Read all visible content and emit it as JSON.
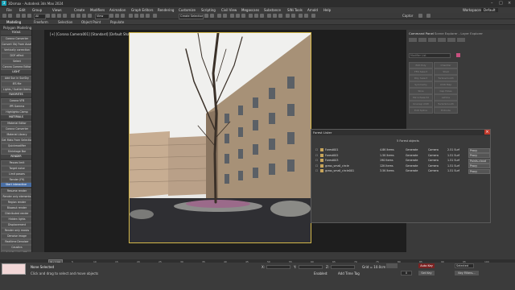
{
  "app": {
    "title": "3Dsmax - Autodesk 3ds Max 2024",
    "menus": [
      "File",
      "Edit",
      "Group",
      "Views",
      "Create",
      "Modifiers",
      "Animation",
      "Graph Editors",
      "Rendering",
      "Customize",
      "Scripting",
      "Civil View",
      "Megascans",
      "Substance",
      "SiNi Tools",
      "Arnold",
      "Help"
    ],
    "workspaces_label": "Workspaces:",
    "workspace_value": "Default",
    "account": "Captor",
    "create_selection_set": "Create Selection Se"
  },
  "ribbon": {
    "tabs": [
      "Modeling",
      "Freeform",
      "Selection",
      "Object Paint",
      "Populate"
    ],
    "sub_label": "Polygon Modeling"
  },
  "viewport": {
    "label": "[+] [Corona Camera001] [Standard] [Default Shading]"
  },
  "left_panel": {
    "items": [
      {
        "label": "TOOLS",
        "style": "hdr"
      },
      {
        "label": "Corona Converter",
        "style": "btn"
      },
      {
        "label": "Convert Obj From Asset",
        "style": "btn"
      },
      {
        "label": "Vertically correction",
        "style": "btn"
      },
      {
        "label": "DOF effect",
        "style": "btn"
      },
      {
        "label": "Select",
        "style": "btn"
      },
      {
        "label": "Corona Camera Editor",
        "style": "btn"
      },
      {
        "label": "LIGHT",
        "style": "hdr"
      },
      {
        "label": "Add Sun in SunSky",
        "style": "btn"
      },
      {
        "label": "IES file",
        "style": "btn"
      },
      {
        "label": "Lights / Scatter Items",
        "style": "btn"
      },
      {
        "label": "FAVORITES",
        "style": "hdr"
      },
      {
        "label": "Corona VFB",
        "style": "btn"
      },
      {
        "label": "IPR Gamma",
        "style": "btn"
      },
      {
        "label": "Highlights Clamp",
        "style": "btn"
      },
      {
        "label": "MATERIALS",
        "style": "hdr"
      },
      {
        "label": "Material Editor",
        "style": "btn"
      },
      {
        "label": "Corona Converter",
        "style": "btn"
      },
      {
        "label": "Material Library",
        "style": "btn"
      },
      {
        "label": "Get Mats From Selection",
        "style": "btn"
      },
      {
        "label": "Quickmodifier",
        "style": "btn"
      },
      {
        "label": "Shrinkage Bar",
        "style": "btn"
      },
      {
        "label": "RENDER",
        "style": "hdr"
      },
      {
        "label": "Passes limit",
        "style": "btn"
      },
      {
        "label": "Target noise",
        "style": "btn"
      },
      {
        "label": "Limit passes",
        "style": "btn"
      },
      {
        "label": "Render (F9)",
        "style": "btn"
      },
      {
        "label": "Start interactive",
        "style": "blue"
      },
      {
        "label": "Resume render",
        "style": "btn"
      },
      {
        "label": "Render only elements",
        "style": "btn"
      },
      {
        "label": "Region render",
        "style": "btn"
      },
      {
        "label": "Blowout render",
        "style": "btn"
      },
      {
        "label": "Distributed render",
        "style": "btn"
      },
      {
        "label": "Hidden lights",
        "style": "btn"
      },
      {
        "label": "Displacement",
        "style": "btn"
      },
      {
        "label": "Render only masks",
        "style": "btn"
      },
      {
        "label": "Denoise image",
        "style": "btn"
      },
      {
        "label": "Realtime Denoiser",
        "style": "btn"
      },
      {
        "label": "Caustics",
        "style": "btn"
      },
      {
        "label": "Add Caustics F.R.",
        "style": "btn"
      }
    ]
  },
  "right_panel": {
    "tabs": [
      "Command Panel",
      "Scene Explorer - Layer Explorer"
    ],
    "dropdown": "Modifier List",
    "buttons": [
      "Edit Poly",
      "Chamfer",
      "FFD Select",
      "Shell",
      "Poly Select",
      "Turbosmooth",
      "Symmetry",
      "UVW Map",
      "Slice",
      "Cap Holes",
      "MirrorSelectd",
      "Lattice",
      "Unwrap UVW",
      "TurboSmooth",
      "Edit Spline",
      "Extrude"
    ]
  },
  "forest_lister": {
    "title": "Forest Lister",
    "summary": "5 Forest objects",
    "rows": [
      {
        "name": "Forest001",
        "items": "4.8K Items",
        "mode": "Generate",
        "camera": "Camera",
        "surf": "2.51 Surf",
        "prop": "Proxy"
      },
      {
        "name": "Forest002",
        "items": "1.5K Items",
        "mode": "Generate",
        "camera": "Camera",
        "surf": "1.51 Surf",
        "prop": "Proxy"
      },
      {
        "name": "Forest003",
        "items": "190 Items",
        "mode": "Generate",
        "camera": "Camera",
        "surf": "1.51 Surf",
        "prop": "Points-cloud"
      },
      {
        "name": "grass_small_circle",
        "items": "12K Items",
        "mode": "Generate",
        "camera": "Camera",
        "surf": "1.51 Surf",
        "prop": "Proxy"
      },
      {
        "name": "grass_small_circle001",
        "items": "3.5K Items",
        "mode": "Generate",
        "camera": "Camera",
        "surf": "1.51 Surf",
        "prop": "Proxy"
      }
    ]
  },
  "timeline": {
    "frame": "0 / 100",
    "ticks": [
      "0",
      "5",
      "10",
      "15",
      "20",
      "25",
      "30",
      "35",
      "40",
      "45",
      "50",
      "55",
      "60",
      "65",
      "70",
      "75",
      "80",
      "85",
      "90",
      "95",
      "100"
    ]
  },
  "status": {
    "selection": "None Selected",
    "prompt": "Click and drag to select and move objects",
    "grid": "Grid = 10.0cm",
    "add_time_tag": "Add Time Tag",
    "enabled": "Enabled:",
    "auto_key": "Auto Key",
    "set_key": "Set Key",
    "selected": "Selected",
    "key_filters": "Key Filters...",
    "frame_value": "0",
    "x_label": "X:",
    "y_label": "Y:",
    "z_label": "Z:"
  }
}
